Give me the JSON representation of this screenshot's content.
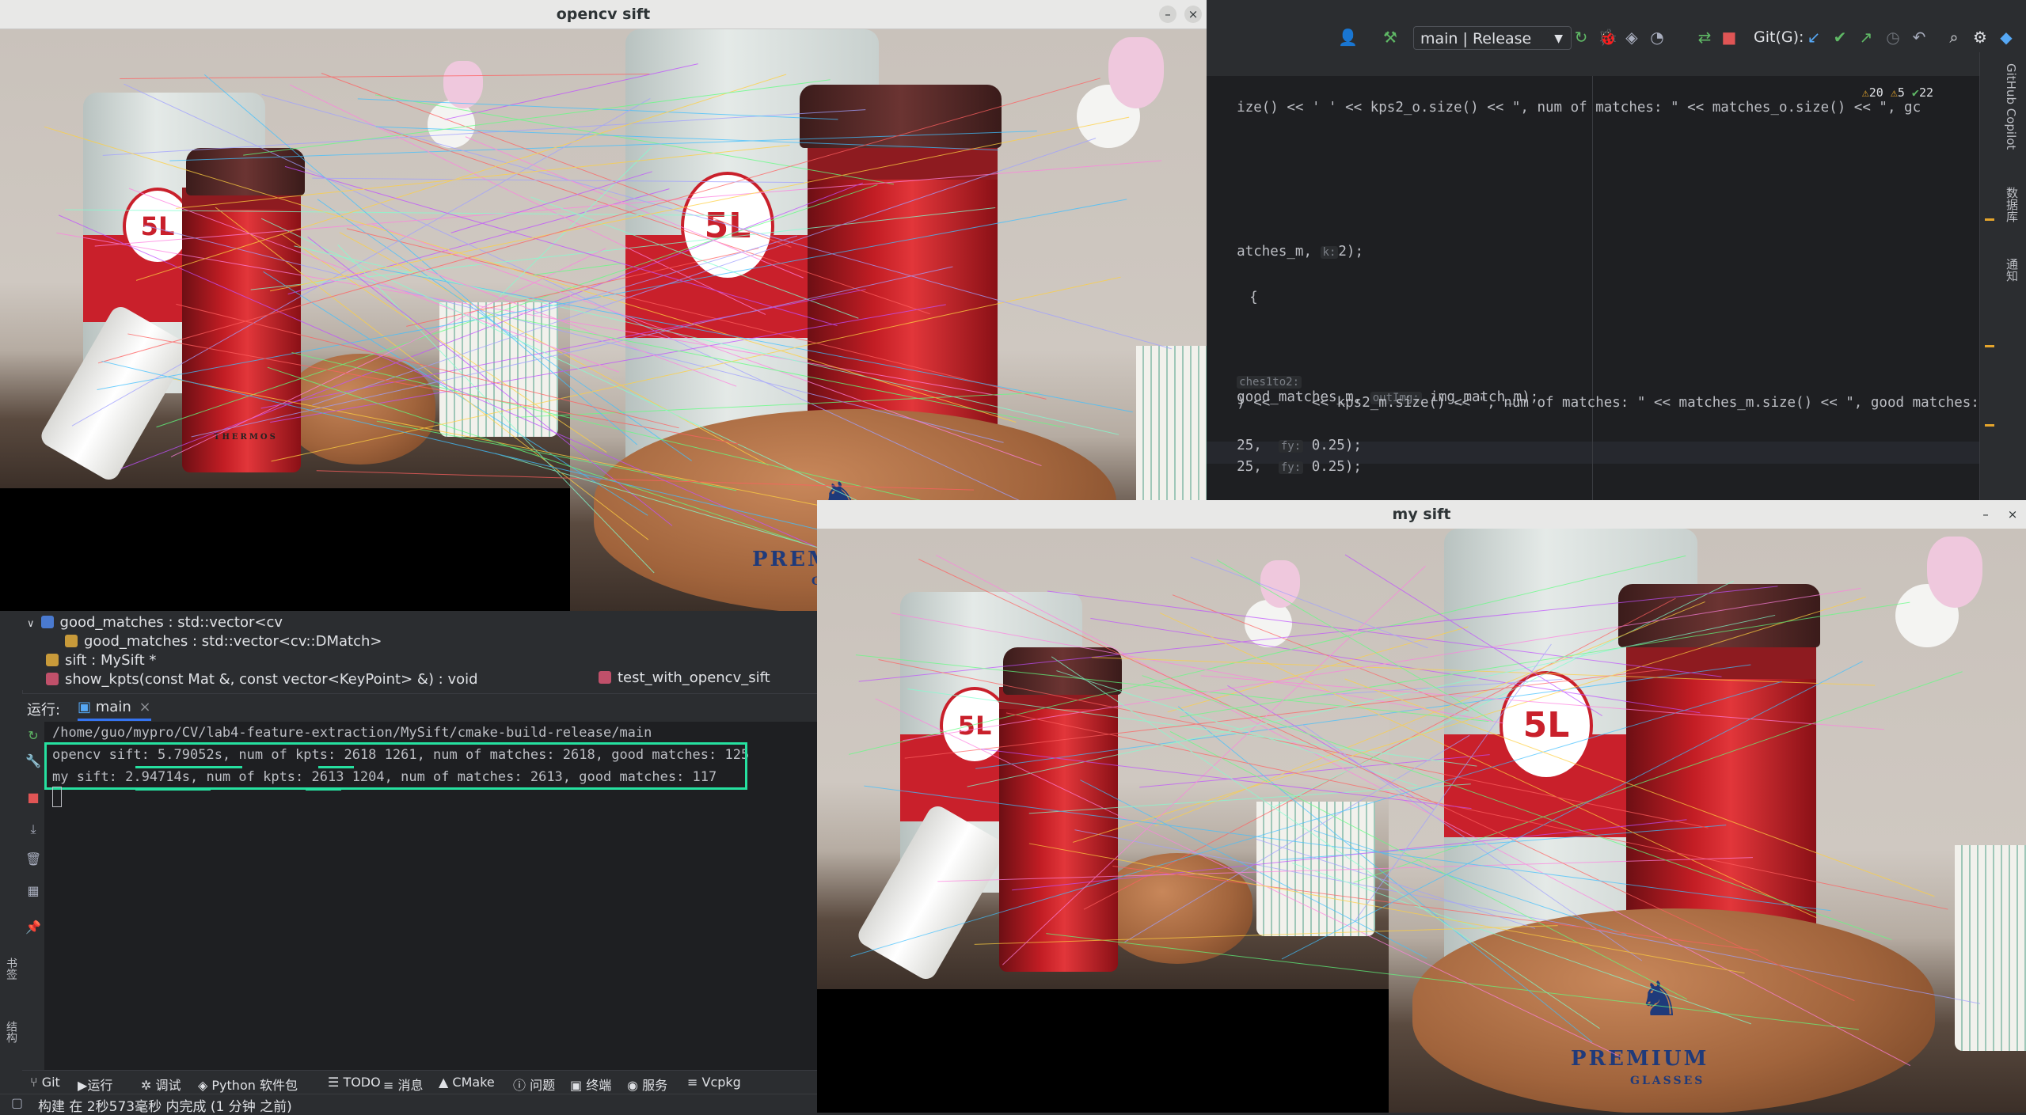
{
  "toolbar": {
    "run_config": "main | Release",
    "git_label": "Git(G):"
  },
  "editor": {
    "lines": [
      {
        "code": "ize() << ' ' << kps2_o.size() << \", num of matches: \" << matches_o.size() << \", gc"
      },
      {
        "code": "atches_m, ",
        "hint": "k:",
        "tail": "2);"
      },
      {
        "code": "{"
      },
      {
        "pre_hint": "ches1to2:",
        "code": "good_matches_m, ",
        "hint": "outImg:",
        "tail": "img_match_m);"
      },
      {
        "code": ") << ' ' << kps2_m.size() << \", num of matches: \" << matches_m.size() << \", good matches: \" << good_m"
      },
      {
        "code": "25, ",
        "hint": "fy:",
        "tail": "0.25);"
      },
      {
        "code": "25, ",
        "hint": "fy:",
        "tail": "0.25);"
      }
    ],
    "inspections": {
      "warnings": "20",
      "weak": "5",
      "ok": "22"
    }
  },
  "right_stripe": {
    "copilot": "GitHub Copilot",
    "database": "数据库",
    "notifications": "通知"
  },
  "windows": {
    "opencv": {
      "title": "opencv sift",
      "min": "–",
      "close": "×"
    },
    "mine": {
      "title": "my sift",
      "min": "–",
      "close": "×"
    }
  },
  "structure": {
    "items": [
      {
        "label": "good_matches : std::vector<cv"
      },
      {
        "label": "good_matches : std::vector<cv::DMatch>"
      },
      {
        "label": "sift : MySift *"
      },
      {
        "label": "show_kpts(const Mat &, const vector<KeyPoint> &) : void"
      }
    ],
    "file_tab": "test_with_opencv_sift"
  },
  "run": {
    "label": "运行:",
    "tab": "main",
    "tab_close": "×"
  },
  "console": {
    "path": "/home/guo/mypro/CV/lab4-feature-extraction/MySift/cmake-build-release/main",
    "line1": "opencv sift: 5.79052s, num of kpts: 2618 1261, num of matches: 2618, good matches: 125",
    "line2": "my sift: 2.94714s, num of kpts: 2613 1204, num of matches: 2613, good matches: 117"
  },
  "tool_tabs": [
    "Git",
    "运行",
    "调试",
    "Python 软件包",
    "TODO",
    "消息",
    "CMake",
    "问题",
    "终端",
    "服务",
    "Vcpkg"
  ],
  "left_stripe": {
    "bookmarks": "书签",
    "structure": "结构"
  },
  "status": {
    "text": "构建 在 2秒573毫秒 内完成 (1 分钟 之前)"
  },
  "photo_text": {
    "jug_label": "5L",
    "case_brand": "PREMIUM",
    "case_sub": "GLASSES",
    "flask_brand": "THERMOS"
  },
  "colors": {
    "accent_box": "#26e0a0",
    "ide_bg": "#2b2d30",
    "editor_bg": "#1e1f22"
  }
}
